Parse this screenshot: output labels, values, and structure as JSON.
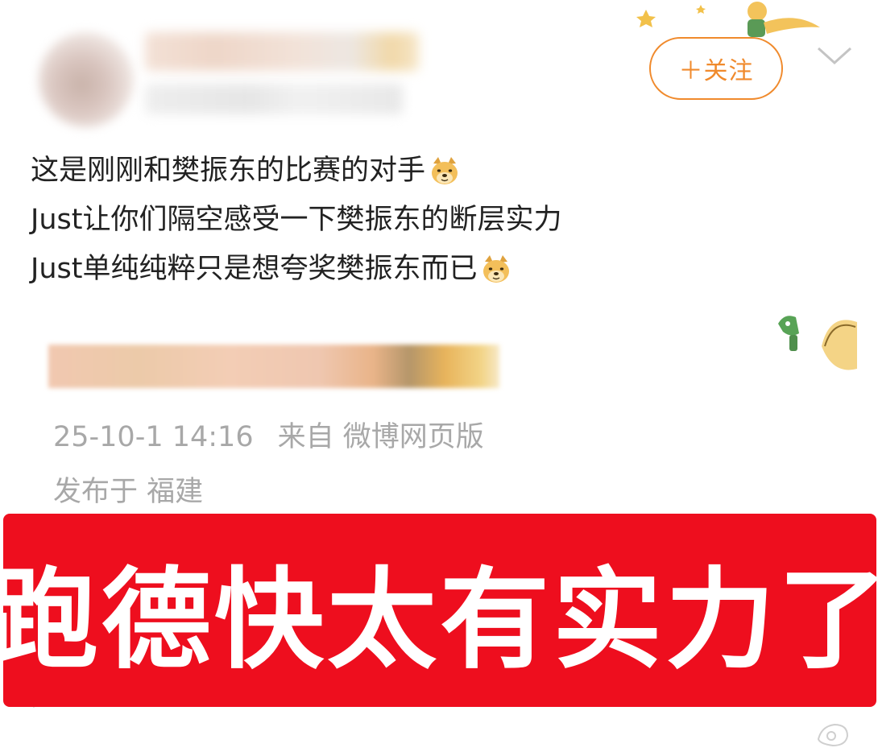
{
  "header": {
    "follow_label": "＋关注",
    "icons": {
      "avatar": "avatar-blurred",
      "chevron": "chevron-down-icon",
      "decoration": "little-prince-decoration"
    }
  },
  "post": {
    "lines": [
      "这是刚刚和樊振东的比赛的对手",
      "Just让你们隔空感受一下樊振东的断层实力",
      "Just单纯纯粹只是想夸奖樊振东而已"
    ],
    "emoji": "doge-emoji"
  },
  "meta": {
    "time": "25-10-1 14:16",
    "source": "来自 微博网页版",
    "location": "发布于 福建"
  },
  "banner": {
    "text": "跑德快太有实力了"
  },
  "colors": {
    "accent": "#f08a2c",
    "meta_text": "#a8a8a8",
    "banner_bg": "#ee0e1e",
    "body_text": "#222222"
  }
}
